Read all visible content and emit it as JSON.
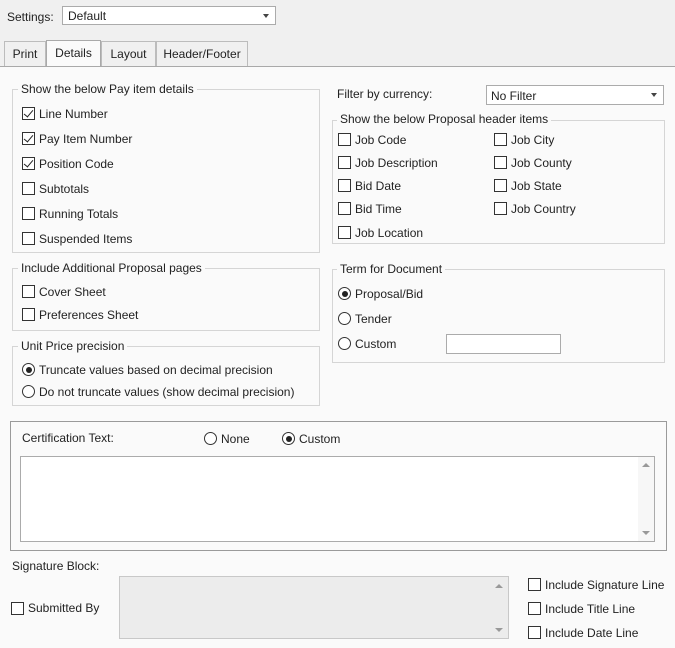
{
  "settings": {
    "label": "Settings:",
    "value": "Default"
  },
  "tabs": [
    {
      "label": "Print"
    },
    {
      "label": "Details"
    },
    {
      "label": "Layout"
    },
    {
      "label": "Header/Footer"
    }
  ],
  "pay_items": {
    "title": "Show the below Pay item details",
    "items": [
      {
        "label": "Line Number",
        "checked": true
      },
      {
        "label": "Pay Item Number",
        "checked": true
      },
      {
        "label": "Position Code",
        "checked": true
      },
      {
        "label": "Subtotals",
        "checked": false
      },
      {
        "label": "Running Totals",
        "checked": false
      },
      {
        "label": "Suspended Items",
        "checked": false
      }
    ]
  },
  "additional_pages": {
    "title": "Include Additional Proposal pages",
    "items": [
      {
        "label": "Cover Sheet",
        "checked": false
      },
      {
        "label": "Preferences Sheet",
        "checked": false
      }
    ]
  },
  "unit_price": {
    "title": "Unit Price precision",
    "options": [
      {
        "label": "Truncate values based on decimal precision",
        "selected": true
      },
      {
        "label": "Do not truncate values (show decimal precision)",
        "selected": false
      }
    ]
  },
  "currency": {
    "label": "Filter by currency:",
    "value": "No Filter"
  },
  "header_items": {
    "title": "Show the below Proposal header items",
    "items": [
      {
        "label": "Job Code",
        "checked": false
      },
      {
        "label": "Job Description",
        "checked": false
      },
      {
        "label": "Bid Date",
        "checked": false
      },
      {
        "label": "Bid Time",
        "checked": false
      },
      {
        "label": "Job Location",
        "checked": false
      },
      {
        "label": "Job City",
        "checked": false
      },
      {
        "label": "Job County",
        "checked": false
      },
      {
        "label": "Job State",
        "checked": false
      },
      {
        "label": "Job Country",
        "checked": false
      }
    ]
  },
  "term": {
    "title": "Term for Document",
    "options": [
      {
        "label": "Proposal/Bid",
        "selected": true
      },
      {
        "label": "Tender",
        "selected": false
      },
      {
        "label": "Custom",
        "selected": false
      }
    ],
    "custom_value": ""
  },
  "certification": {
    "label": "Certification Text:",
    "none_label": "None",
    "custom_label": "Custom",
    "selected": "custom",
    "text": ""
  },
  "signature": {
    "label": "Signature Block:",
    "submitted_by": {
      "label": "Submitted By",
      "checked": false
    },
    "text": "",
    "options": [
      {
        "label": "Include Signature Line",
        "checked": false
      },
      {
        "label": "Include Title Line",
        "checked": false
      },
      {
        "label": "Include Date Line",
        "checked": false
      }
    ]
  }
}
